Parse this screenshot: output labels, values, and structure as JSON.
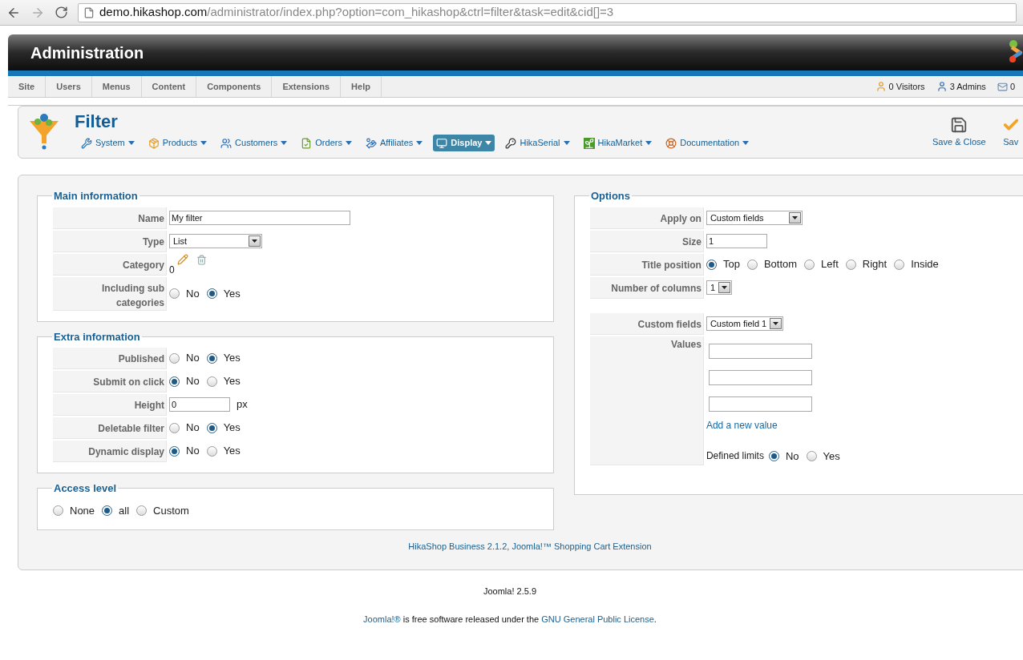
{
  "browser": {
    "url_host": "demo.hikashop.com",
    "url_path": "/administrator/index.php?option=com_hikashop&ctrl=filter&task=edit&cid[]=3"
  },
  "header": {
    "title": "Administration"
  },
  "menu": [
    "Site",
    "Users",
    "Menus",
    "Content",
    "Components",
    "Extensions",
    "Help"
  ],
  "status": [
    "0 Visitors",
    "3 Admins",
    "0"
  ],
  "page": {
    "title": "Filter",
    "submenu": [
      {
        "label": "System",
        "selected": false
      },
      {
        "label": "Products",
        "selected": false
      },
      {
        "label": "Customers",
        "selected": false
      },
      {
        "label": "Orders",
        "selected": false
      },
      {
        "label": "Affiliates",
        "selected": false
      },
      {
        "label": "Display",
        "selected": true
      },
      {
        "label": "HikaSerial",
        "selected": false
      },
      {
        "label": "HikaMarket",
        "selected": false
      },
      {
        "label": "Documentation",
        "selected": false
      }
    ],
    "toolbar": [
      "Save & Close",
      "Sav"
    ]
  },
  "main_information": {
    "legend": "Main information",
    "rows": [
      {
        "kind": "text",
        "label": "Name",
        "value": "My filter"
      },
      {
        "kind": "select",
        "label": "Type",
        "value": "List"
      },
      {
        "kind": "category",
        "label": "Category",
        "value": "0"
      },
      {
        "kind": "radio",
        "label": "Including sub categories",
        "options": [
          {
            "label": "No",
            "selected": false
          },
          {
            "label": "Yes",
            "selected": true
          }
        ]
      }
    ]
  },
  "extra_information": {
    "legend": "Extra information",
    "rows": [
      {
        "kind": "radio",
        "label": "Published",
        "options": [
          {
            "label": "No",
            "selected": false
          },
          {
            "label": "Yes",
            "selected": true
          }
        ]
      },
      {
        "kind": "radio",
        "label": "Submit on click",
        "options": [
          {
            "label": "No",
            "selected": true
          },
          {
            "label": "Yes",
            "selected": false
          }
        ]
      },
      {
        "kind": "text",
        "label": "Height",
        "value": "0",
        "unit": "px"
      },
      {
        "kind": "radio",
        "label": "Deletable filter",
        "options": [
          {
            "label": "No",
            "selected": false
          },
          {
            "label": "Yes",
            "selected": true
          }
        ]
      },
      {
        "kind": "radio",
        "label": "Dynamic display",
        "options": [
          {
            "label": "No",
            "selected": true
          },
          {
            "label": "Yes",
            "selected": false
          }
        ]
      }
    ]
  },
  "access_level": {
    "legend": "Access level",
    "options": [
      {
        "label": "None",
        "selected": false
      },
      {
        "label": "all",
        "selected": true
      },
      {
        "label": "Custom",
        "selected": false
      }
    ]
  },
  "options": {
    "legend": "Options",
    "rows": [
      {
        "kind": "select",
        "label": "Apply on",
        "value": "Custom fields"
      },
      {
        "kind": "text",
        "label": "Size",
        "value": "1"
      },
      {
        "kind": "radio",
        "label": "Title position",
        "options": [
          {
            "label": "Top",
            "selected": true
          },
          {
            "label": "Bottom",
            "selected": false
          },
          {
            "label": "Left",
            "selected": false
          },
          {
            "label": "Right",
            "selected": false
          },
          {
            "label": "Inside",
            "selected": false
          }
        ]
      },
      {
        "kind": "select",
        "label": "Number of columns",
        "value": "1"
      }
    ],
    "field_rows": [
      {
        "kind": "select",
        "label": "Custom fields",
        "value": "Custom field 1"
      }
    ],
    "values": {
      "label": "Values",
      "link": "Add a new value",
      "limits": {
        "label": "Defined limits",
        "options": [
          {
            "label": "No",
            "selected": true
          },
          {
            "label": "Yes",
            "selected": false
          }
        ]
      }
    }
  },
  "footer": {
    "credit": "HikaShop Business 2.1.2, Joomla!™ Shopping Cart Extension",
    "version": "Joomla! 2.5.9",
    "license": {
      "link_1": "Joomla!®",
      "text": "is free software released under the",
      "link_2": "GNU General Public License",
      "end": "."
    }
  }
}
